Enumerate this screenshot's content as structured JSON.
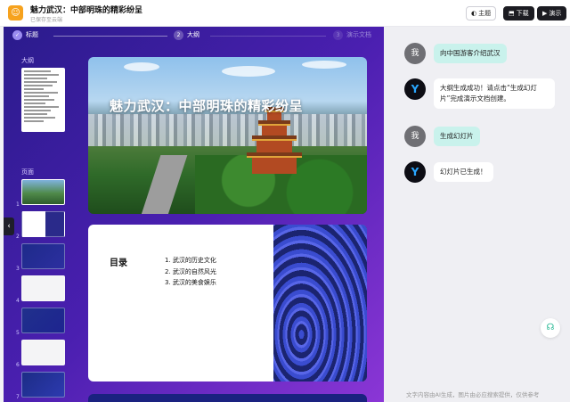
{
  "header": {
    "app_icon": "chat-bubble-icon",
    "title": "魅力武汉：中部明珠的精彩纷呈",
    "save_status": "已保存至云端",
    "buttons": {
      "theme": "主题",
      "download": "下载",
      "present": "演示"
    }
  },
  "steps": [
    {
      "num": "✓",
      "label": "标题"
    },
    {
      "num": "2",
      "label": "大纲"
    },
    {
      "num": "3",
      "label": "演示文档"
    }
  ],
  "sidebar": {
    "outline_label": "大纲",
    "pages_label": "页面",
    "pages": [
      "1",
      "2",
      "3",
      "4",
      "5",
      "6",
      "7"
    ]
  },
  "slides": {
    "cover_title": "魅力武汉：中部明珠的精彩纷呈",
    "toc_title": "目录",
    "toc_items": [
      "1. 武汉的历史文化",
      "2. 武汉的自然风光",
      "3. 武汉的美食娱乐"
    ]
  },
  "chat": {
    "user_avatar": "我",
    "bot_avatar": "Y",
    "messages": [
      {
        "role": "user",
        "text": "向中国游客介绍武汉"
      },
      {
        "role": "bot",
        "text": "大纲生成成功！请点击“生成幻灯片”完成演示文档创建。"
      },
      {
        "role": "user",
        "text": "生成幻灯片"
      },
      {
        "role": "bot",
        "text": "幻灯片已生成！"
      }
    ],
    "disclaimer": "文字内容由AI生成，图片由必应搜索提供，仅供参考"
  }
}
